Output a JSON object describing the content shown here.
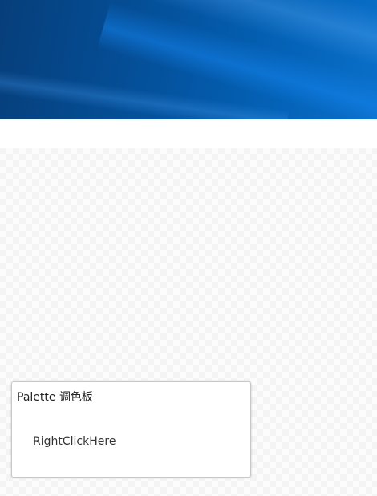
{
  "desktop": {
    "wallpaper_colors": [
      "#063e7a",
      "#04539f",
      "#0a6fc9"
    ]
  },
  "palette_panel": {
    "title": "Palette 调色板",
    "hint": "RightClickHere"
  }
}
